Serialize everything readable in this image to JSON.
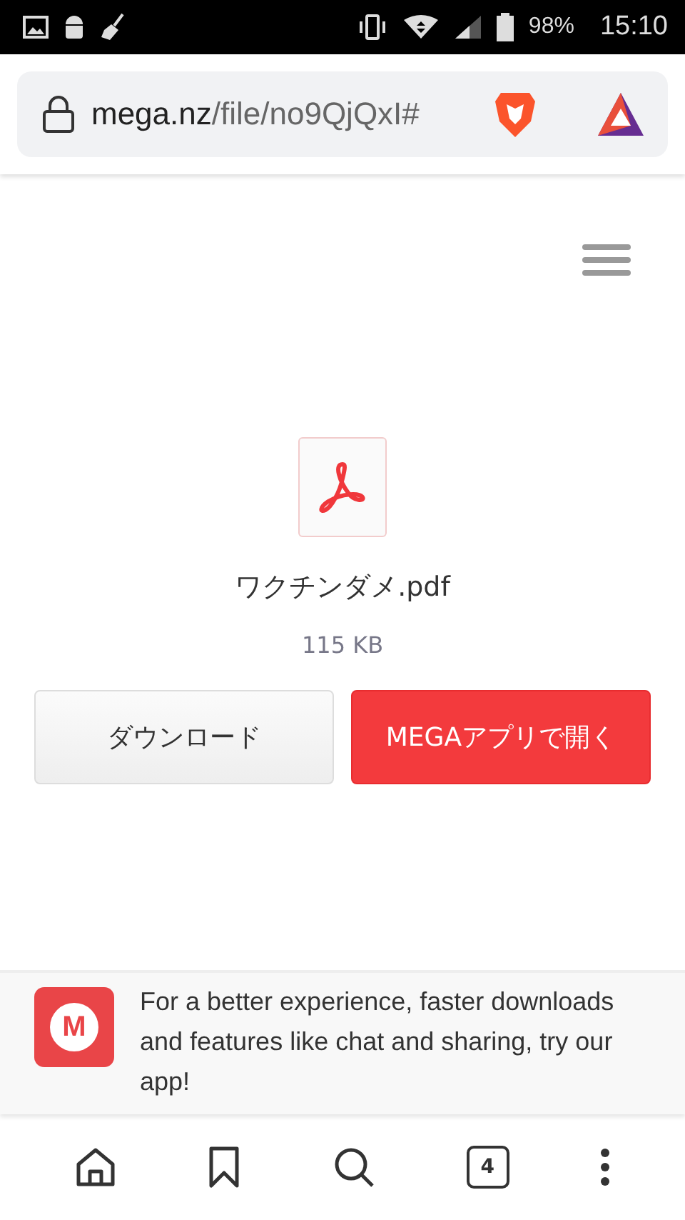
{
  "status_bar": {
    "battery": "98%",
    "time": "15:10"
  },
  "address_bar": {
    "domain": "mega.nz",
    "path": "/file/no9QjQxI#"
  },
  "file": {
    "name": "ワクチンダメ.pdf",
    "size": "115 KB"
  },
  "buttons": [
    {
      "label": "ダウンロード",
      "kind": "secondary"
    },
    {
      "label": "MEGAアプリで開く",
      "kind": "primary"
    }
  ],
  "app_banner": {
    "logo_letter": "M",
    "text": "For a better experience, faster downloads and features like chat and sharing, try our app!"
  },
  "bottom_nav": {
    "tab_count": "4"
  }
}
